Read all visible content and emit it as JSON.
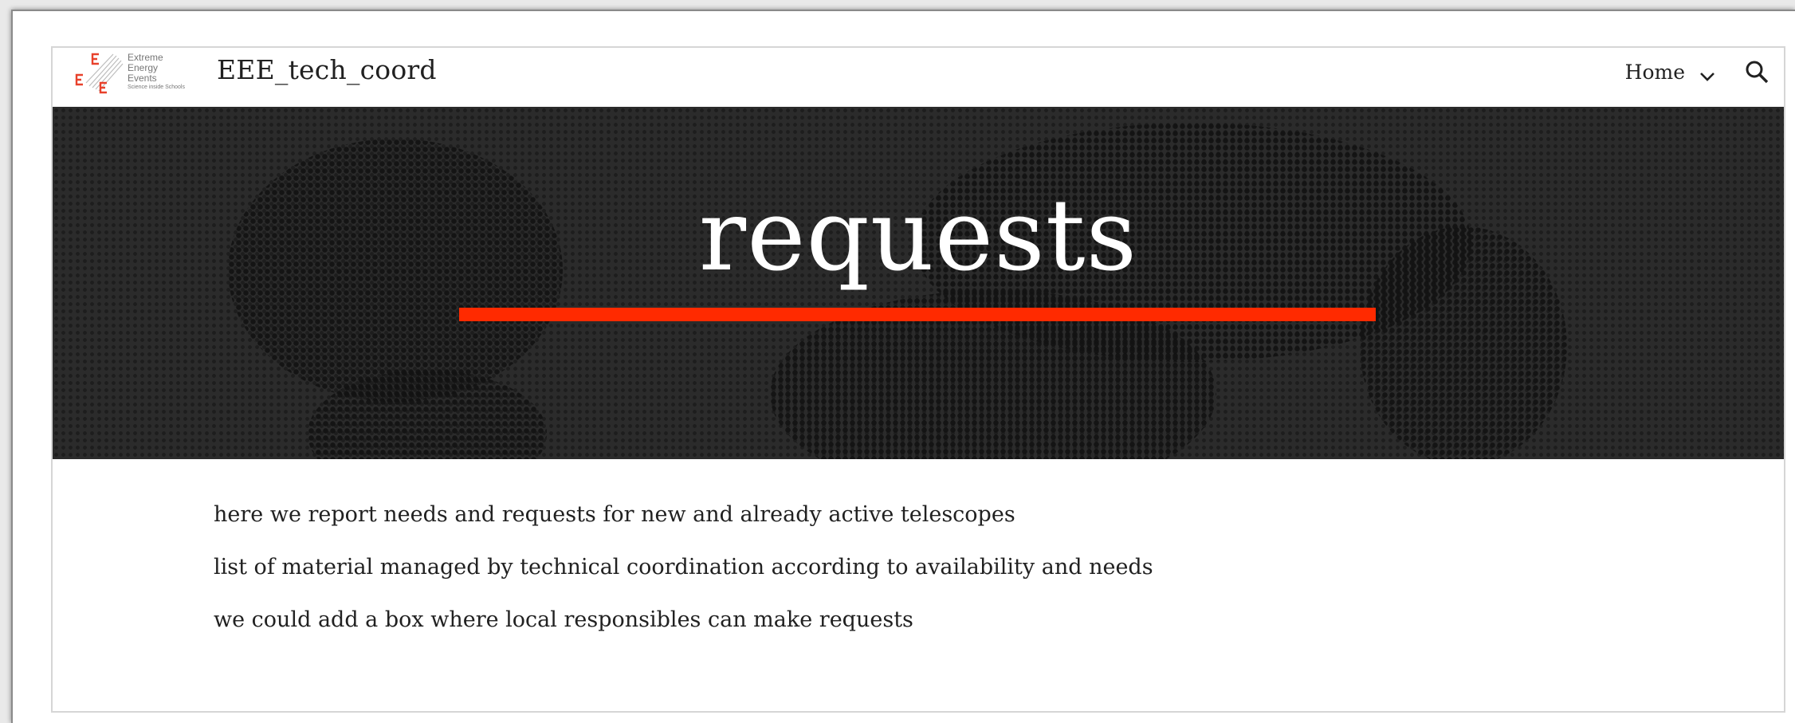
{
  "header": {
    "logo": {
      "lines": [
        "Extreme",
        "Energy",
        "Events"
      ],
      "tagline": "Science inside Schools",
      "accent_color": "#e8412b"
    },
    "site_title": "EEE_tech_coord",
    "nav": {
      "home_label": "Home",
      "chevron_icon": "chevron-down-icon",
      "search_icon": "search-icon"
    }
  },
  "hero": {
    "title": "requests",
    "underline_color": "#ff2a00",
    "background_color": "#2b2b2b"
  },
  "content": {
    "paragraphs": [
      "here we report needs and requests for new and already active telescopes",
      "list of material managed by technical coordination according to availability and needs",
      "we could add a box where local responsibles can make requests"
    ]
  }
}
